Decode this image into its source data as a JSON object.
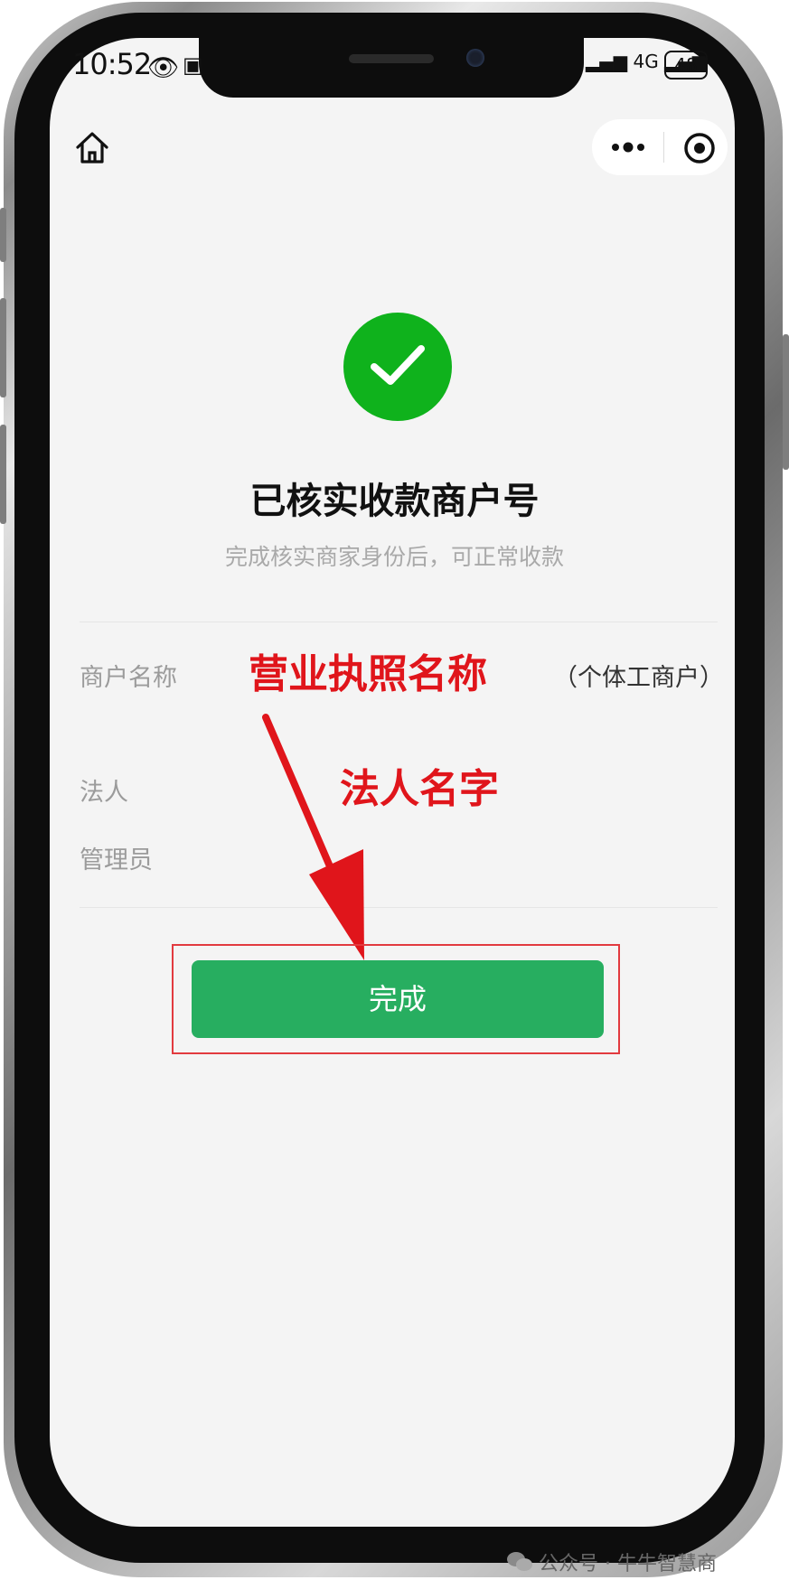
{
  "status_bar": {
    "time": "10:52",
    "network": "4G",
    "battery": "48"
  },
  "nav": {
    "home_icon": "home-icon",
    "more_icon": "more-dots-icon",
    "close_icon": "target-circle-icon"
  },
  "result": {
    "icon": "check-icon",
    "icon_color": "#0fb21c",
    "title": "已核实收款商户号",
    "subtitle": "完成核实商家身份后，可正常收款"
  },
  "info": {
    "merchant_label": "商户名称",
    "merchant_value": "（个体工商户）",
    "legal_label": "法人",
    "admin_label": "管理员"
  },
  "annotations": {
    "business_license_name": "营业执照名称",
    "legal_person_name": "法人名字",
    "color": "#e0151b"
  },
  "actions": {
    "done_label": "完成",
    "done_color": "#27ae60"
  },
  "watermark": {
    "text": "公众号 · 牛牛智慧商"
  }
}
